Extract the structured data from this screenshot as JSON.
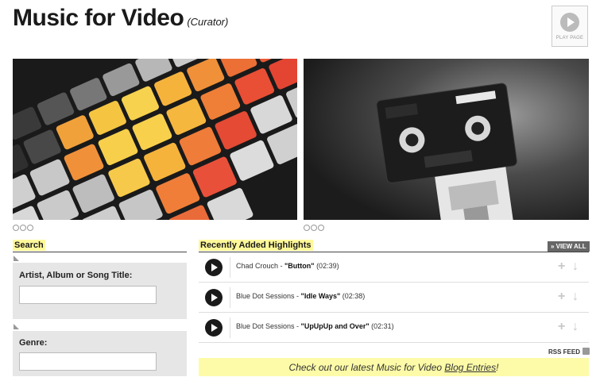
{
  "header": {
    "title": "Music for Video",
    "curator": "(Curator)",
    "play_page_label": "PLAY PAGE"
  },
  "images": {
    "left": "keyboard-keys-photo",
    "right": "cassette-robot-photo"
  },
  "search": {
    "heading": "Search",
    "title_label": "Artist, Album or Song Title:",
    "title_value": "",
    "genre_label": "Genre:",
    "genre_value": ""
  },
  "highlights": {
    "heading": "Recently Added Highlights",
    "view_all": "» VIEW ALL",
    "tracks": [
      {
        "artist": "Chad Crouch - ",
        "title": "\"Button\"",
        "duration": " (02:39)"
      },
      {
        "artist": "Blue Dot Sessions - ",
        "title": "\"Idle Ways\"",
        "duration": " (02:38)"
      },
      {
        "artist": "Blue Dot Sessions - ",
        "title": "\"UpUpUp and Over\"",
        "duration": " (02:31)"
      }
    ],
    "rss_label": "RSS FEED"
  },
  "blog": {
    "text_before": "Check out our latest Music for Video ",
    "link_text": "Blog Entries",
    "text_after": "!"
  },
  "colors": {
    "highlight": "#fff89a",
    "banner": "#fdfba8"
  }
}
